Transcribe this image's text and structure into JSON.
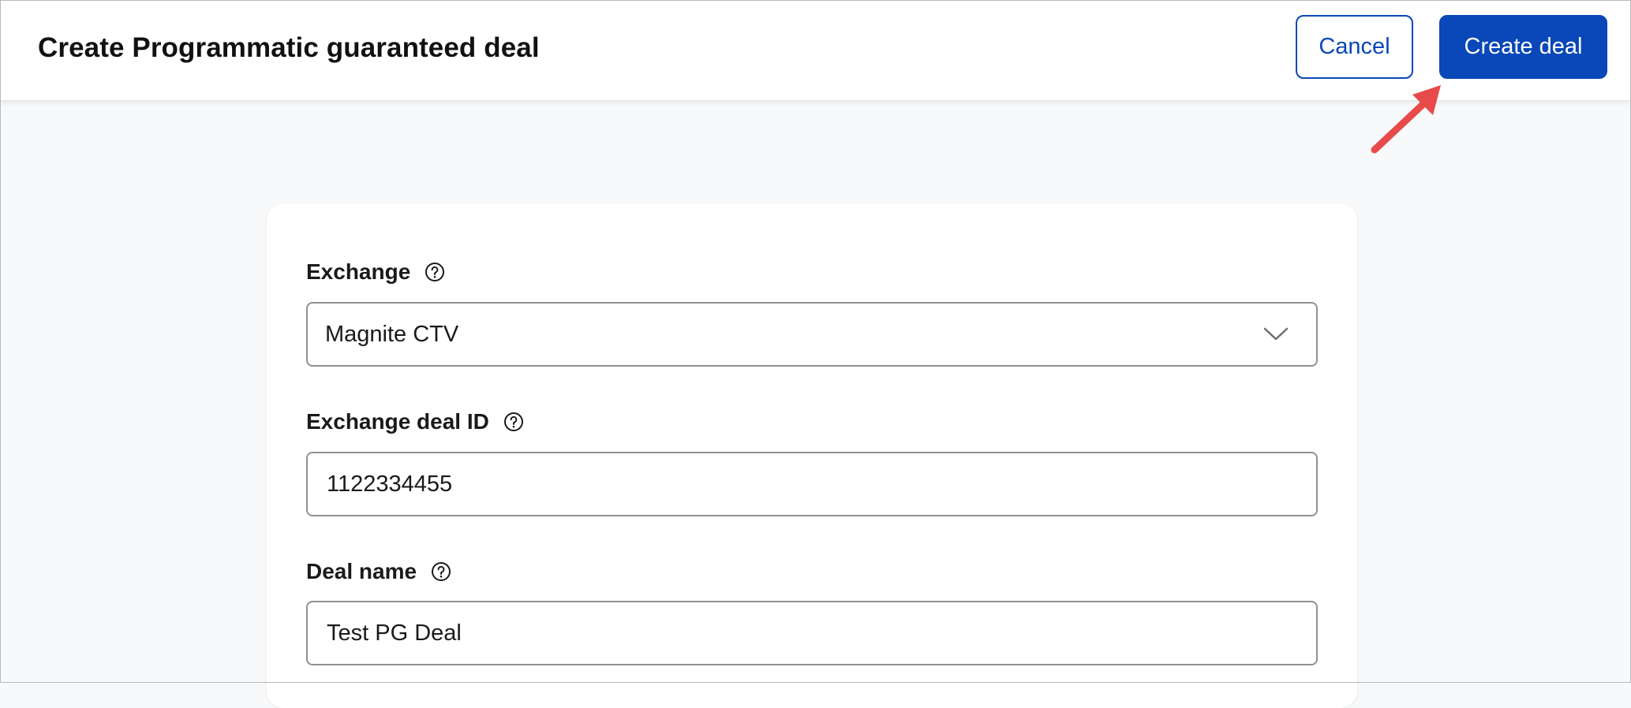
{
  "header": {
    "title": "Create Programmatic guaranteed deal",
    "cancel_label": "Cancel",
    "create_label": "Create deal"
  },
  "form": {
    "exchange": {
      "label": "Exchange",
      "selected_value": "Magnite CTV",
      "icon": "help-circle-icon"
    },
    "exchange_deal_id": {
      "label": "Exchange deal ID",
      "value": "1122334455",
      "icon": "help-circle-icon"
    },
    "deal_name": {
      "label": "Deal name",
      "value": "Test PG Deal",
      "icon": "help-circle-icon"
    }
  },
  "colors": {
    "primary": "#0a47b8",
    "annotation_arrow": "#e84a4a",
    "page_bg": "#f8f9fa",
    "input_border": "#8e9196"
  }
}
